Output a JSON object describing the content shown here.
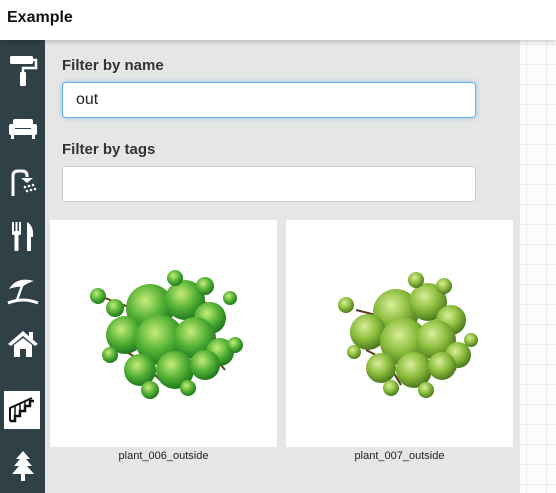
{
  "header": {
    "title": "Example"
  },
  "sidebar": {
    "items": [
      {
        "icon": "paint-roller-icon"
      },
      {
        "icon": "sofa-icon"
      },
      {
        "icon": "shower-icon"
      },
      {
        "icon": "fork-knife-icon"
      },
      {
        "icon": "beach-umbrella-icon"
      },
      {
        "icon": "house-icon"
      },
      {
        "icon": "stairs-icon",
        "active": true
      },
      {
        "icon": "tree-icon"
      }
    ]
  },
  "filters": {
    "name_label": "Filter by name",
    "name_value": "out",
    "tags_label": "Filter by tags",
    "tags_value": ""
  },
  "results": [
    {
      "name": "plant_006_outside"
    },
    {
      "name": "plant_007_outside"
    }
  ],
  "colors": {
    "sidebar": "#2f4047",
    "panel": "#e6e6e6",
    "focus": "#66afe9"
  }
}
